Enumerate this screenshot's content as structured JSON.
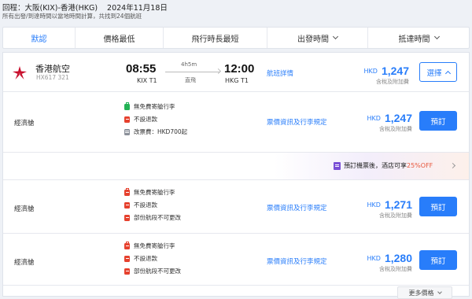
{
  "header": {
    "route": "回程：大阪(KIX)-香港(HKG)",
    "date": "2024年11月18日",
    "note": "所有出發/到達時間以當地時間計算，共找到24個航班"
  },
  "sort_tabs": [
    {
      "label": "默認",
      "active": true,
      "has_dropdown": false
    },
    {
      "label": "價格最低",
      "active": false,
      "has_dropdown": false
    },
    {
      "label": "飛行時長最短",
      "active": false,
      "has_dropdown": false
    },
    {
      "label": "出發時間",
      "active": false,
      "has_dropdown": true
    },
    {
      "label": "抵達時間",
      "active": false,
      "has_dropdown": true
    }
  ],
  "flight": {
    "airline": "香港航空",
    "flight_no": "HX617 321",
    "depart_time": "08:55",
    "depart_airport": "KIX T1",
    "duration": "4h5m",
    "stops": "直飛",
    "arrive_time": "12:00",
    "arrive_airport": "HKG T1",
    "details_link": "航班詳情",
    "currency": "HKD",
    "price": "1,247",
    "price_note": "含稅及附加費",
    "select_label": "選擇"
  },
  "fares": [
    {
      "class": "經濟艙",
      "features": [
        {
          "icon": "baggage-icon",
          "color": "#23b255",
          "text": "無免費寄艙行李"
        },
        {
          "icon": "no-refund-icon",
          "color": "#e6412e",
          "text": "不設退款"
        },
        {
          "icon": "change-fee-icon",
          "color": "#8a8f99",
          "text": "改票費：HKD700起"
        }
      ],
      "rules_link": "票價資訊及行李規定",
      "currency": "HKD",
      "price": "1,247",
      "price_note": "含稅及附加費",
      "book_label": "預訂"
    },
    {
      "class": "經濟艙",
      "features": [
        {
          "icon": "baggage-icon",
          "color": "#e6412e",
          "text": "無免費寄艙行李"
        },
        {
          "icon": "no-refund-icon",
          "color": "#e6412e",
          "text": "不設退款"
        },
        {
          "icon": "no-change-icon",
          "color": "#e6412e",
          "text": "部份航段不可更改"
        }
      ],
      "rules_link": "票價資訊及行李規定",
      "currency": "HKD",
      "price": "1,271",
      "price_note": "含稅及附加費",
      "book_label": "預訂"
    },
    {
      "class": "經濟艙",
      "features": [
        {
          "icon": "baggage-icon",
          "color": "#e6412e",
          "text": "無免費寄艙行李"
        },
        {
          "icon": "no-refund-icon",
          "color": "#e6412e",
          "text": "不設退款"
        },
        {
          "icon": "no-change-icon",
          "color": "#e6412e",
          "text": "部份航段不可更改"
        }
      ],
      "rules_link": "票價資訊及行李規定",
      "currency": "HKD",
      "price": "1,280",
      "price_note": "含稅及附加費",
      "book_label": "預訂"
    }
  ],
  "promo": {
    "text_prefix": "預訂機票後，酒店可享",
    "discount": "25%OFF"
  },
  "more_prices": "更多價格",
  "colors": {
    "accent": "#287dfa",
    "discount": "#e8553a",
    "airline_red": "#c8102e"
  }
}
